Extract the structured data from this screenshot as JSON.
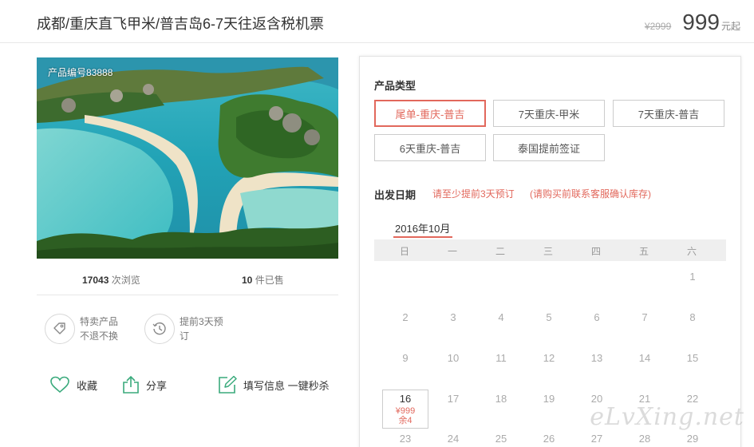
{
  "header": {
    "title": "成都/重庆直飞甲米/普吉岛6-7天往返含税机票",
    "old_price": "¥2999",
    "price": "999",
    "unit": "元起"
  },
  "product": {
    "code": "产品编号83888",
    "views_count": "17043",
    "views_label": " 次浏览",
    "sold_count": "10",
    "sold_label": " 件已售"
  },
  "features": [
    {
      "icon": "tag-icon",
      "line1": "特卖产品",
      "line2": "不退不换"
    },
    {
      "icon": "clock-icon",
      "line1": "提前3天预",
      "line2": "订"
    }
  ],
  "actions": {
    "favorite": "收藏",
    "share": "分享",
    "fill_info": "填写信息 一键秒杀"
  },
  "booking": {
    "type_title": "产品类型",
    "options": [
      "尾单-重庆-普吉",
      "7天重庆-甲米",
      "7天重庆-普吉",
      "6天重庆-普吉",
      "泰国提前签证"
    ],
    "selected_index": 0,
    "date_title": "出发日期",
    "note1": "请至少提前3天预订",
    "note2": "(请购买前联系客服确认库存)",
    "month": "2016年10月",
    "weekdays": [
      "日",
      "一",
      "二",
      "三",
      "四",
      "五",
      "六"
    ],
    "rows": [
      [
        "",
        "",
        "",
        "",
        "",
        "",
        "1"
      ],
      [
        "2",
        "3",
        "4",
        "5",
        "6",
        "7",
        "8"
      ],
      [
        "9",
        "10",
        "11",
        "12",
        "13",
        "14",
        "15"
      ],
      [
        "",
        "17",
        "18",
        "19",
        "20",
        "21",
        "22"
      ],
      [
        "23",
        "24",
        "25",
        "26",
        "27",
        "28",
        "29"
      ]
    ],
    "available_day": {
      "day": "16",
      "price": "¥999",
      "stock": "余4"
    }
  },
  "watermark": "eLvXing.net",
  "colors": {
    "accent": "#e2685c",
    "icon_green": "#3aaa7c"
  }
}
